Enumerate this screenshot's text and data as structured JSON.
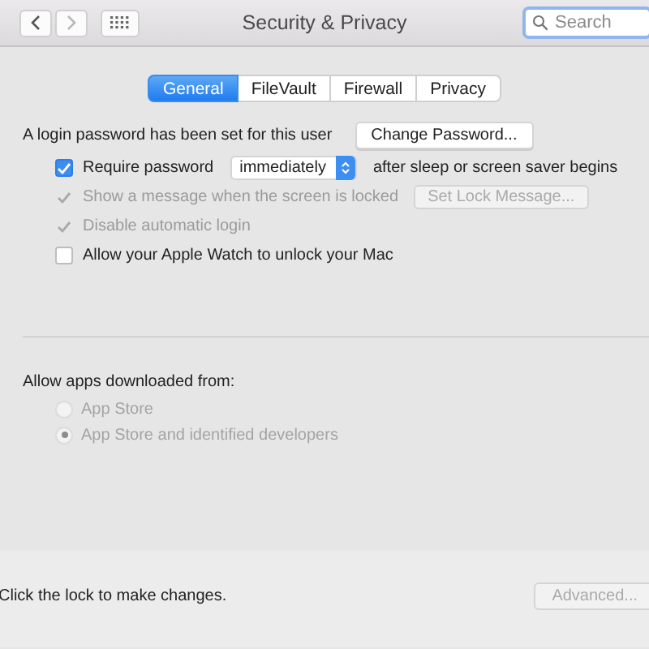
{
  "window": {
    "title": "Security & Privacy"
  },
  "nav": [
    {
      "kind": "back",
      "disabled": false
    },
    {
      "kind": "forward",
      "disabled": true
    }
  ],
  "search": {
    "placeholder": "Search"
  },
  "tabs": [
    {
      "label": "General",
      "selected": true
    },
    {
      "label": "FileVault",
      "selected": false
    },
    {
      "label": "Firewall",
      "selected": false
    },
    {
      "label": "Privacy",
      "selected": false
    }
  ],
  "login": {
    "text": "A login password has been set for this user",
    "button": "Change Password..."
  },
  "options": [
    {
      "label": "Require password",
      "checked": true,
      "disabled": false,
      "popup": "immediately",
      "suffix": "after sleep or screen saver begins"
    },
    {
      "label": "Show a message when the screen is locked",
      "checked": true,
      "disabled": true,
      "button": "Set Lock Message...",
      "button_disabled": true
    },
    {
      "label": "Disable automatic login",
      "checked": true,
      "disabled": true
    },
    {
      "label": "Allow your Apple Watch to unlock your Mac",
      "checked": false,
      "disabled": false
    }
  ],
  "downloads": {
    "heading": "Allow apps downloaded from:",
    "choices": [
      {
        "label": "App Store",
        "selected": false,
        "disabled": true
      },
      {
        "label": "App Store and identified developers",
        "selected": true,
        "disabled": true
      }
    ]
  },
  "footer": {
    "text": "Click the lock to make changes.",
    "button": "Advanced...",
    "button_disabled": true
  }
}
